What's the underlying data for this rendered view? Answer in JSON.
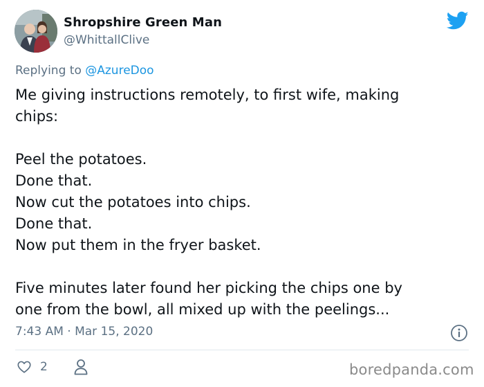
{
  "author": {
    "display_name": "Shropshire Green Man",
    "handle": "@WhittallClive",
    "avatar_icon": "profile-photo"
  },
  "reply": {
    "prefix": "Replying to ",
    "mention": "@AzureDoo"
  },
  "tweet": {
    "lines": [
      "Me giving instructions remotely, to first wife, making",
      "chips:",
      "",
      "Peel the potatoes.",
      "Done that.",
      "Now cut the potatoes into chips.",
      "Done that.",
      "Now put them in the fryer basket.",
      "",
      "Five minutes later found her picking the chips one by",
      "one from the bowl, all mixed up with the peelings..."
    ],
    "timestamp": "7:43 AM · Mar 15, 2020"
  },
  "actions": {
    "like_count": "2",
    "like_icon": "heart-outline-icon",
    "profile_icon": "person-outline-icon",
    "info_icon": "info-icon"
  },
  "brand": {
    "logo_icon": "twitter-bird-icon",
    "accent_color": "#1da1f2",
    "muted_color": "#5b7083"
  },
  "watermark": "boredpanda.com"
}
